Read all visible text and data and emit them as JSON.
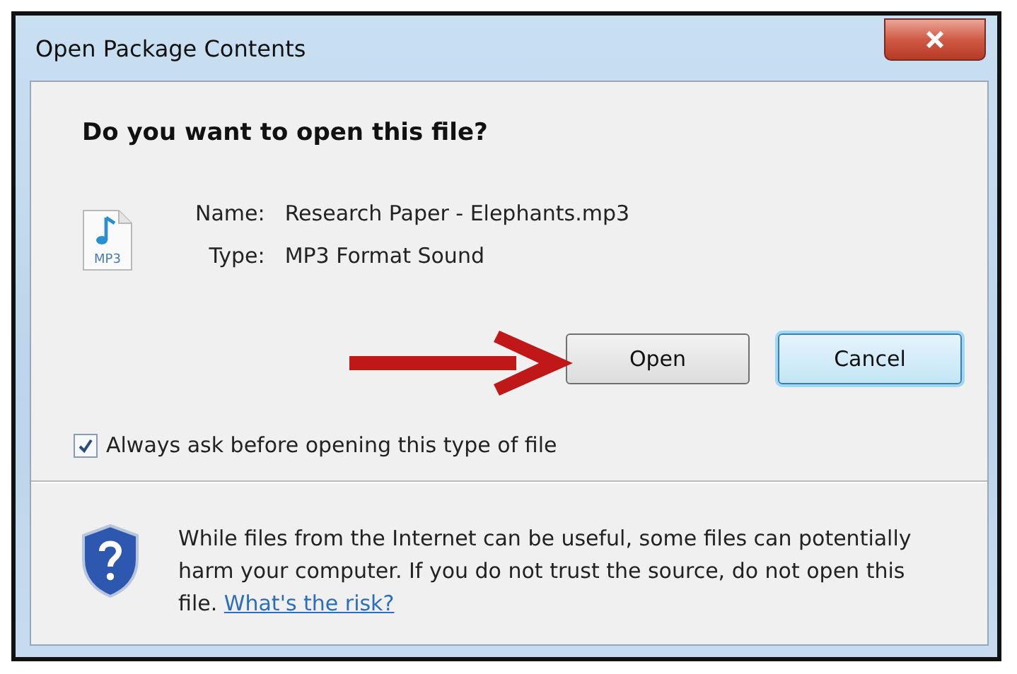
{
  "window": {
    "title": "Open Package Contents"
  },
  "heading": "Do you want to open this file?",
  "file": {
    "icon_label": "MP3",
    "fields": [
      {
        "label": "Name:",
        "value": "Research Paper - Elephants.mp3"
      },
      {
        "label": "Type:",
        "value": "MP3 Format Sound"
      }
    ]
  },
  "buttons": [
    {
      "label": "Open",
      "focused": false
    },
    {
      "label": "Cancel",
      "focused": true
    }
  ],
  "checkbox": {
    "label": "Always ask before opening this type of file",
    "checked": true
  },
  "warning": {
    "text": "While files from the Internet can be useful, some files can potentially harm your computer. If you do not trust the source, do not open this file.",
    "link": "What's the risk?"
  }
}
